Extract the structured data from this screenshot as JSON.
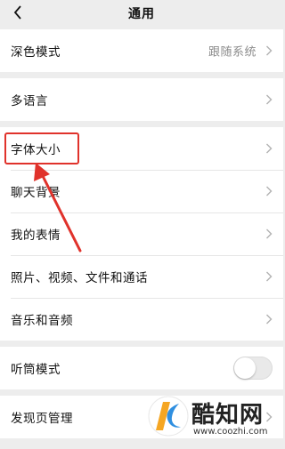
{
  "header": {
    "title": "通用",
    "back_icon": "chevron-left-icon"
  },
  "rows": {
    "dark_mode": {
      "label": "深色模式",
      "value": "跟随系统"
    },
    "language": {
      "label": "多语言"
    },
    "font_size": {
      "label": "字体大小"
    },
    "chat_background": {
      "label": "聊天背景"
    },
    "my_stickers": {
      "label": "我的表情"
    },
    "media_files": {
      "label": "照片、视频、文件和通话"
    },
    "music_audio": {
      "label": "音乐和音频"
    },
    "earpiece_mode": {
      "label": "听筒模式",
      "toggle_on": false
    },
    "discover_manage": {
      "label": "发现页管理"
    }
  },
  "annotation": {
    "color": "#e0322b"
  },
  "watermark": {
    "name": "酷知网",
    "url": "www.coozhi.com"
  },
  "colors": {
    "background": "#ededed",
    "row": "#ffffff",
    "secondary_text": "#8c8c8c",
    "accent_orange": "#f5a623",
    "accent_blue": "#2f8fe0"
  }
}
